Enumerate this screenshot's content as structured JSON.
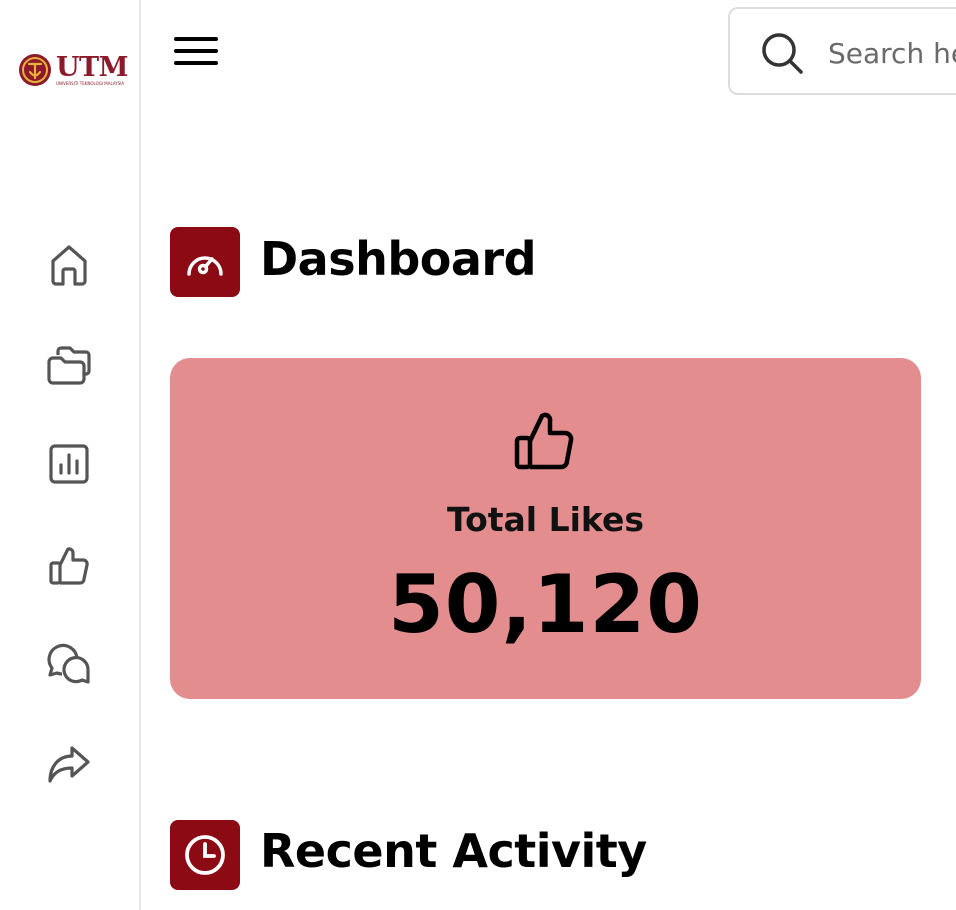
{
  "brand": {
    "name": "UTM",
    "subtitle": "UNIVERSITI TEKNOLOGI MALAYSIA",
    "color": "#8c1a2b"
  },
  "sidebar": {
    "items": [
      {
        "icon": "home-icon"
      },
      {
        "icon": "folders-icon"
      },
      {
        "icon": "bar-chart-icon"
      },
      {
        "icon": "thumbs-up-icon"
      },
      {
        "icon": "chat-bubbles-icon"
      },
      {
        "icon": "share-icon"
      }
    ]
  },
  "header": {
    "menu_icon": "hamburger-menu-icon",
    "search": {
      "icon": "search-icon",
      "placeholder": "Search here"
    }
  },
  "dashboard": {
    "title": "Dashboard",
    "icon": "speedometer-icon",
    "accent": "#8b0a14"
  },
  "stats_card": {
    "icon": "thumbs-up-icon",
    "label": "Total Likes",
    "value": "50,120",
    "background": "#e38d8e"
  },
  "recent_activity": {
    "title": "Recent Activity",
    "icon": "clock-icon"
  }
}
